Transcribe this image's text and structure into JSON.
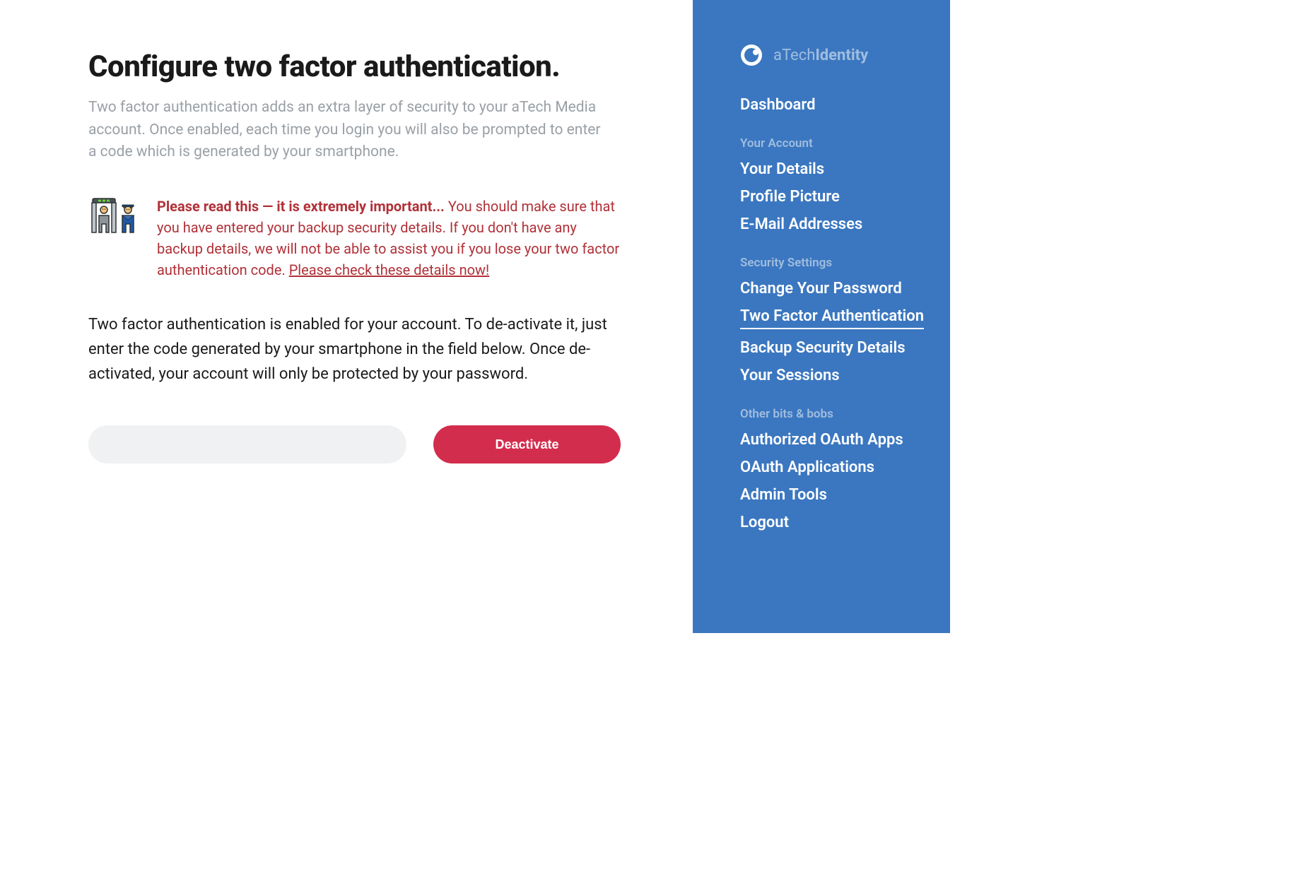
{
  "main": {
    "title": "Configure two factor authentication.",
    "description": "Two factor authentication adds an extra layer of security to your aTech Media account. Once enabled, each time you login you will also be prompted to enter a code which is generated by your smartphone.",
    "warning": {
      "strong": "Please read this — it is extremely important...",
      "body": " You should make sure that you have entered your backup security details. If you don't have any backup details, we will not be able to assist you if you lose your two factor authentication code. ",
      "link": "Please check these details now!"
    },
    "instructions": "Two factor authentication is enabled for your account. To de-activate it, just enter the code generated by your smartphone in the field below. Once de-activated, your account will only be protected by your password.",
    "form": {
      "code_value": "",
      "deactivate_label": "Deactivate"
    }
  },
  "sidebar": {
    "logo": {
      "prefix": "aTech",
      "suffix": "Identity"
    },
    "dashboard": "Dashboard",
    "sections": [
      {
        "heading": "Your Account",
        "items": [
          {
            "label": "Your Details",
            "active": false
          },
          {
            "label": "Profile Picture",
            "active": false
          },
          {
            "label": "E-Mail Addresses",
            "active": false
          }
        ]
      },
      {
        "heading": "Security Settings",
        "items": [
          {
            "label": "Change Your Password",
            "active": false
          },
          {
            "label": "Two Factor Authentication",
            "active": true
          },
          {
            "label": "Backup Security Details",
            "active": false
          },
          {
            "label": "Your Sessions",
            "active": false
          }
        ]
      },
      {
        "heading": "Other bits & bobs",
        "items": [
          {
            "label": "Authorized OAuth Apps",
            "active": false
          },
          {
            "label": "OAuth Applications",
            "active": false
          },
          {
            "label": "Admin Tools",
            "active": false
          },
          {
            "label": "Logout",
            "active": false
          }
        ]
      }
    ]
  }
}
